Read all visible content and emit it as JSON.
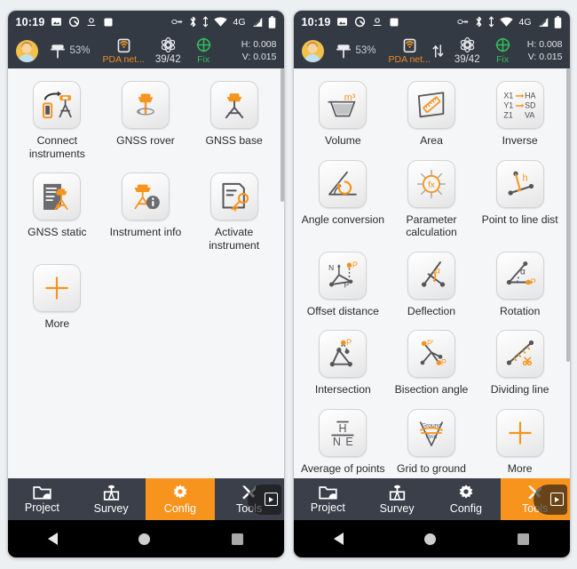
{
  "panels": [
    {
      "id": "config-panel",
      "statusbar": {
        "clock": "10:19",
        "left_icons": [
          "image-icon",
          "quick-search-icon",
          "location-icon",
          "app-icon"
        ],
        "right_icons": [
          "link-icon",
          "bluetooth-icon",
          "data-transfer-icon",
          "wifi-icon",
          "signal-4g-icon",
          "battery-icon"
        ],
        "network_label": "4G"
      },
      "gnssbar": {
        "avatar": "user-avatar",
        "battery_percent": "53%",
        "network_label": "PDA net...",
        "has_updown_icon": false,
        "satellites": "39/42",
        "fix_status": "Fix",
        "h_precision": "H: 0.008",
        "v_precision": "V: 0.015"
      },
      "tiles": [
        {
          "label": "Connect instruments",
          "icon": "connect-instruments-icon"
        },
        {
          "label": "GNSS rover",
          "icon": "gnss-rover-icon"
        },
        {
          "label": "GNSS base",
          "icon": "gnss-base-icon"
        },
        {
          "label": "GNSS static",
          "icon": "gnss-static-icon"
        },
        {
          "label": "Instrument info",
          "icon": "instrument-info-icon"
        },
        {
          "label": "Activate instrument",
          "icon": "activate-instrument-icon"
        },
        {
          "label": "More",
          "icon": "plus-icon"
        }
      ],
      "tabs": [
        {
          "label": "Project",
          "icon": "folder-icon",
          "active": false
        },
        {
          "label": "Survey",
          "icon": "survey-stake-icon",
          "active": false
        },
        {
          "label": "Config",
          "icon": "gear-icon",
          "active": true
        },
        {
          "label": "Tools",
          "icon": "tools-icon",
          "active": false
        }
      ],
      "navbar": [
        "back-button",
        "home-button",
        "recents-button"
      ]
    },
    {
      "id": "tools-panel",
      "statusbar": {
        "clock": "10:19",
        "left_icons": [
          "image-icon",
          "quick-search-icon",
          "location-icon",
          "app-icon"
        ],
        "right_icons": [
          "link-icon",
          "bluetooth-icon",
          "data-transfer-icon",
          "wifi-icon",
          "signal-4g-icon",
          "battery-icon"
        ],
        "network_label": "4G"
      },
      "gnssbar": {
        "avatar": "user-avatar",
        "battery_percent": "53%",
        "network_label": "PDA net...",
        "has_updown_icon": true,
        "satellites": "39/42",
        "fix_status": "Fix",
        "h_precision": "H: 0.008",
        "v_precision": "V: 0.015"
      },
      "tiles": [
        {
          "label": "Volume",
          "icon": "volume-icon"
        },
        {
          "label": "Area",
          "icon": "area-icon"
        },
        {
          "label": "Inverse",
          "icon": "inverse-icon"
        },
        {
          "label": "Angle conversion",
          "icon": "angle-conversion-icon"
        },
        {
          "label": "Parameter calculation",
          "icon": "parameter-calculation-icon"
        },
        {
          "label": "Point to line dist",
          "icon": "point-to-line-dist-icon"
        },
        {
          "label": "Offset distance",
          "icon": "offset-distance-icon"
        },
        {
          "label": "Deflection",
          "icon": "deflection-icon"
        },
        {
          "label": "Rotation",
          "icon": "rotation-icon"
        },
        {
          "label": "Intersection",
          "icon": "intersection-icon"
        },
        {
          "label": "Bisection angle",
          "icon": "bisection-angle-icon"
        },
        {
          "label": "Dividing line",
          "icon": "dividing-line-icon"
        },
        {
          "label": "Average of points",
          "icon": "average-of-points-icon"
        },
        {
          "label": "Grid to ground",
          "icon": "grid-to-ground-icon"
        },
        {
          "label": "More",
          "icon": "plus-icon"
        }
      ],
      "tabs": [
        {
          "label": "Project",
          "icon": "folder-icon",
          "active": false
        },
        {
          "label": "Survey",
          "icon": "survey-stake-icon",
          "active": false
        },
        {
          "label": "Config",
          "icon": "gear-icon",
          "active": false
        },
        {
          "label": "Tools",
          "icon": "tools-icon",
          "active": true
        }
      ],
      "navbar": [
        "back-button",
        "home-button",
        "recents-button"
      ]
    }
  ],
  "icon_text": {
    "inverse": [
      "X1",
      "HA",
      "Y1",
      "SD",
      "Z1",
      "VA"
    ],
    "volume_unit": "m³",
    "parameter_fx": "fx",
    "point_to_line_h": "h",
    "offset_N": "N",
    "offset_P": "P",
    "offset_Pprime": "P'",
    "deflection_alpha": "α",
    "rotation_alpha": "α",
    "rotation_P": "P",
    "intersection_P": "P",
    "bisection_P": "P",
    "bisection_Pprime": "P'",
    "average_H": "H",
    "average_N": "N",
    "average_E": "E",
    "grid_ground": "Ground",
    "grid_grid": "Grid"
  },
  "colors": {
    "accent": "#f7941d",
    "bar_bg": "#343a44",
    "tabbar_bg": "#3a3f49",
    "page_bg": "#f5f6f8",
    "fix_green": "#2fbf5a",
    "icon_dark": "#55565a"
  }
}
